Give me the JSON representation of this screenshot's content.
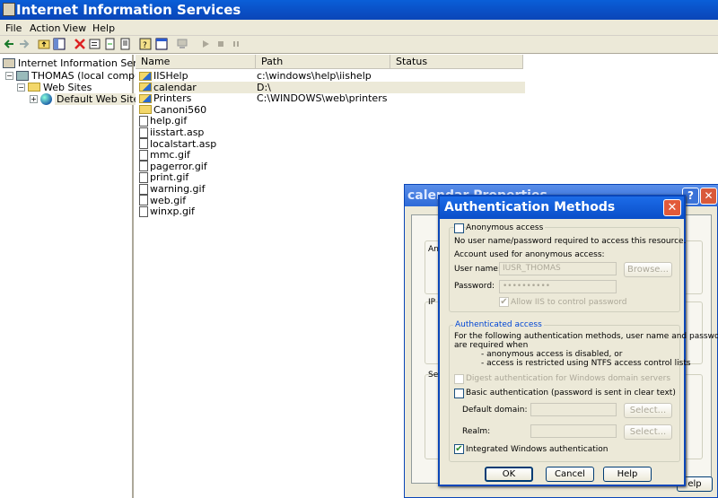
{
  "app": {
    "title": "Internet Information Services"
  },
  "menu": {
    "items": [
      "File",
      "Action",
      "View",
      "Help"
    ]
  },
  "tree": {
    "root": "Internet Information Services",
    "computer": "THOMAS (local computer)",
    "web_sites": "Web Sites",
    "default_site": "Default Web Site"
  },
  "list": {
    "columns": [
      "Name",
      "Path",
      "Status"
    ],
    "rows": [
      {
        "name": "IISHelp",
        "path": "c:\\windows\\help\\iishelp",
        "icon": "virtual-dir-icon"
      },
      {
        "name": "calendar",
        "path": "D:\\",
        "icon": "virtual-dir-icon"
      },
      {
        "name": "Printers",
        "path": "C:\\WINDOWS\\web\\printers",
        "icon": "virtual-dir-icon"
      },
      {
        "name": "Canoni560",
        "path": "",
        "icon": "folder-icon"
      },
      {
        "name": "help.gif",
        "path": "",
        "icon": "file-icon"
      },
      {
        "name": "iisstart.asp",
        "path": "",
        "icon": "file-icon"
      },
      {
        "name": "localstart.asp",
        "path": "",
        "icon": "file-icon"
      },
      {
        "name": "mmc.gif",
        "path": "",
        "icon": "file-icon"
      },
      {
        "name": "pagerror.gif",
        "path": "",
        "icon": "file-icon"
      },
      {
        "name": "print.gif",
        "path": "",
        "icon": "file-icon"
      },
      {
        "name": "warning.gif",
        "path": "",
        "icon": "file-icon"
      },
      {
        "name": "web.gif",
        "path": "",
        "icon": "file-icon"
      },
      {
        "name": "winxp.gif",
        "path": "",
        "icon": "file-icon"
      }
    ]
  },
  "props": {
    "title": "calendar Properties",
    "frag_anon": "Anon",
    "frag_ip": "IP a",
    "frag_sec": "Sec",
    "help_fragment": "elp"
  },
  "auth": {
    "title": "Authentication Methods",
    "anonymous_label": "Anonymous access",
    "anonymous_desc": "No user name/password required to access this resource.",
    "account_label": "Account used for anonymous access:",
    "username_label": "User name:",
    "username_value": "IUSR_THOMAS",
    "browse_label": "Browse...",
    "password_label": "Password:",
    "password_value": "••••••••••",
    "allow_iis_label": "Allow IIS to control password",
    "authenticated_header": "Authenticated access",
    "desc_line1": "For the following authentication methods, user name and password",
    "desc_line2": "are required when",
    "desc_line3": "- anonymous access is disabled, or",
    "desc_line4": "- access is restricted using NTFS access control lists",
    "digest_label": "Digest authentication for Windows domain servers",
    "basic_label": "Basic authentication (password is sent in clear text)",
    "default_domain_label": "Default domain:",
    "realm_label": "Realm:",
    "select_label": "Select...",
    "integrated_label": "Integrated Windows authentication",
    "ok": "OK",
    "cancel": "Cancel",
    "help": "Help",
    "anonymous_checked": false,
    "basic_checked": false,
    "integrated_checked": true
  },
  "colors": {
    "title_blue": "#0a4ec4",
    "dialog_face": "#ece9d8",
    "selection": "#ece9d8"
  }
}
